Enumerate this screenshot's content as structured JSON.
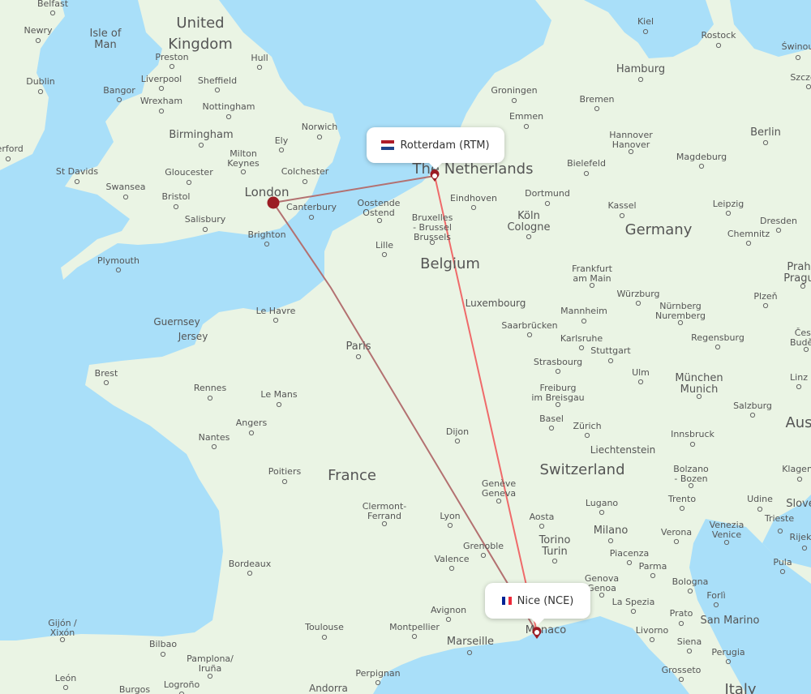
{
  "map": {
    "colors": {
      "water": "#a9dff9",
      "land": "#eaf4e4",
      "route_london": "#b37171",
      "route_nice": "#ef6a6a",
      "origin_marker": "#9b1c24"
    },
    "origin": {
      "name": "London",
      "marker_icon": "filled-circle"
    },
    "airports": [
      {
        "id": "rtm",
        "label": "Rotterdam (RTM)",
        "country_flag": "netherlands-flag"
      },
      {
        "id": "nce",
        "label": "Nice (NCE)",
        "country_flag": "france-flag"
      }
    ],
    "routes": [
      {
        "from": "London",
        "to": "Rotterdam (RTM)"
      },
      {
        "from": "London",
        "to": "Nice (NCE)"
      },
      {
        "from": "Rotterdam (RTM)",
        "to": "Nice (NCE)"
      }
    ],
    "countries": [
      "United Kingdom",
      "The Netherlands",
      "Belgium",
      "Germany",
      "France",
      "Switzerland",
      "Italy",
      "Aus"
    ],
    "cities": [
      "Belfast",
      "Newry",
      "Isle of Man",
      "Dublin",
      "Preston",
      "Hull",
      "Liverpool",
      "Sheffield",
      "Bangor",
      "Wrexham",
      "Nottingham",
      "Birmingham",
      "Norwich",
      "Ely",
      "Milton Keynes",
      "terford",
      "St Davids",
      "Swansea",
      "Gloucester",
      "Colchester",
      "London",
      "Bristol",
      "Canterbury",
      "Salisbury",
      "Brighton",
      "Plymouth",
      "Guernsey",
      "Jersey",
      "Le Havre",
      "Brest",
      "Rennes",
      "Le Mans",
      "Angers",
      "Nantes",
      "Poitiers",
      "Paris",
      "Oostende Ostend",
      "Bruxelles - Brussel Brussels",
      "Lille",
      "Eindhoven",
      "Luxembourg",
      "Saarbrücken",
      "Strasbourg",
      "Dijon",
      "Genève Geneva",
      "Lyon",
      "Clermont-Ferrand",
      "Bordeaux",
      "Grenoble",
      "Valence",
      "Avignon",
      "Toulouse",
      "Montpellier",
      "Marseille",
      "Perpignan",
      "Andorra",
      "Gijón / Xixón",
      "Bilbao",
      "Pamplona/ Iruña",
      "León",
      "Burgos",
      "Logroño",
      "Kiel",
      "Rostock",
      "Świnoujście",
      "Szczecin",
      "Hamburg",
      "Groningen",
      "Bremen",
      "Emmen",
      "Hannover Hanover",
      "Berlin",
      "Bielefeld",
      "Magdeburg",
      "Dortmund",
      "Kassel",
      "Leipzig",
      "Dresden",
      "Chemnitz",
      "Köln Cologne",
      "Frankfurt am Main",
      "Würzburg",
      "Mannheim",
      "Nürnberg Nuremberg",
      "Karlsruhe",
      "Stuttgart",
      "Regensburg",
      "Ulm",
      "München Munich",
      "Freiburg im Breisgau",
      "Basel",
      "Zürich",
      "Liechtenstein",
      "Innsbruck",
      "Salzburg",
      "Linz",
      "Praha Prague",
      "Plzeň",
      "České Budějovice",
      "Bolzano - Bozen",
      "Klagenfurt",
      "Lugano",
      "Aosta",
      "Trento",
      "Udine",
      "Slovenia",
      "Milano",
      "Torino Turin",
      "Verona",
      "Venezia Venice",
      "Trieste",
      "Rijeka",
      "Piacenza",
      "Parma",
      "Pula",
      "Genova Genoa",
      "Bologna",
      "Forlì",
      "La Spezia",
      "Prato",
      "San Marino",
      "Livorno",
      "Siena",
      "Perugia",
      "Grosseto",
      "Monaco"
    ]
  }
}
